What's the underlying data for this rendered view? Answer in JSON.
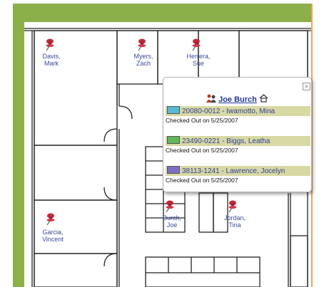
{
  "people": [
    {
      "id": "davis",
      "line1": "Davis,",
      "line2": "Mark"
    },
    {
      "id": "myers",
      "line1": "Myers,",
      "line2": "Zach"
    },
    {
      "id": "herrera",
      "line1": "Herrera,",
      "line2": "Sue"
    },
    {
      "id": "garcia",
      "line1": "Garcia,",
      "line2": "Vincent"
    },
    {
      "id": "burch",
      "line1": "Burch,",
      "line2": "Joe"
    },
    {
      "id": "jordan",
      "line1": "Jordan,",
      "line2": "Tina"
    }
  ],
  "popup": {
    "close_label": "×",
    "person_name": "Joe Burch",
    "person_icon": "people-icon",
    "home_icon": "home-icon",
    "entries": [
      {
        "title": "20080-0012 - Iwamotto, Mina",
        "status": "Checked Out on 5/25/2007",
        "icon": "folder-arrow-icon",
        "icon_color": "#5ab7d6"
      },
      {
        "title": "23490-0221 - Biggs, Leatha",
        "status": "Checked Out on 5/25/2007",
        "icon": "folder-icon",
        "icon_color": "#5fb85a"
      },
      {
        "title": "38113-1241 - Lawrence, Jocelyn",
        "status": "Checked Out on 5/25/2007",
        "icon": "folder-arrow-icon",
        "icon_color": "#7d6fc4"
      }
    ]
  },
  "colors": {
    "frame_green": "#8bb04a",
    "frame_orange": "#f0a35a",
    "label_blue": "#3a4a9a",
    "entry_bar": "#d8d8a3",
    "pin_red": "#c0283a"
  }
}
